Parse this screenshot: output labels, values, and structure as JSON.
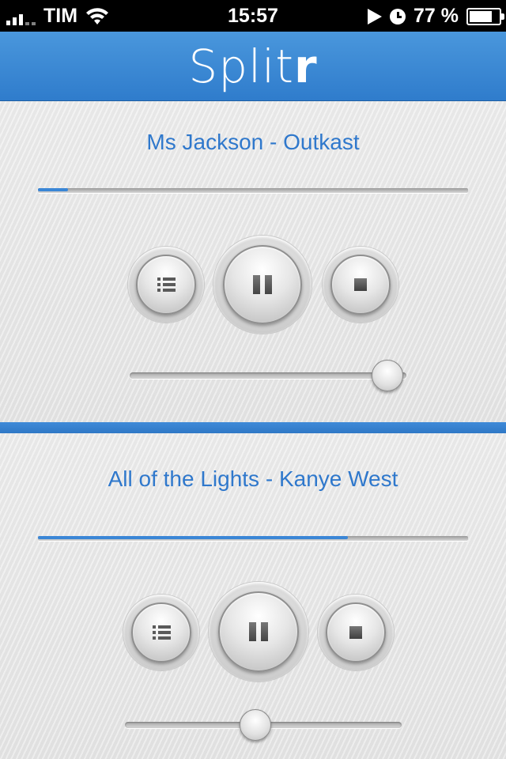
{
  "status_bar": {
    "carrier": "TIM",
    "time": "15:57",
    "battery_percent": "77 %",
    "battery_level": 0.77,
    "icons": [
      "signal-icon",
      "wifi-icon",
      "play-icon",
      "alarm-icon",
      "battery-icon"
    ]
  },
  "header": {
    "title_main": "Split",
    "title_accent": "r"
  },
  "players": [
    {
      "track": "Ms Jackson - Outkast",
      "progress": 0.07,
      "volume": 0.93,
      "buttons": [
        "list-icon",
        "pause-icon",
        "stop-icon"
      ]
    },
    {
      "track": "All of the Lights - Kanye West",
      "progress": 0.72,
      "volume": 0.47,
      "buttons": [
        "list-icon",
        "pause-icon",
        "stop-icon"
      ]
    }
  ],
  "colors": {
    "accent": "#2f78cc",
    "header": "#3a88d6",
    "panel": "#e8e8e8"
  }
}
